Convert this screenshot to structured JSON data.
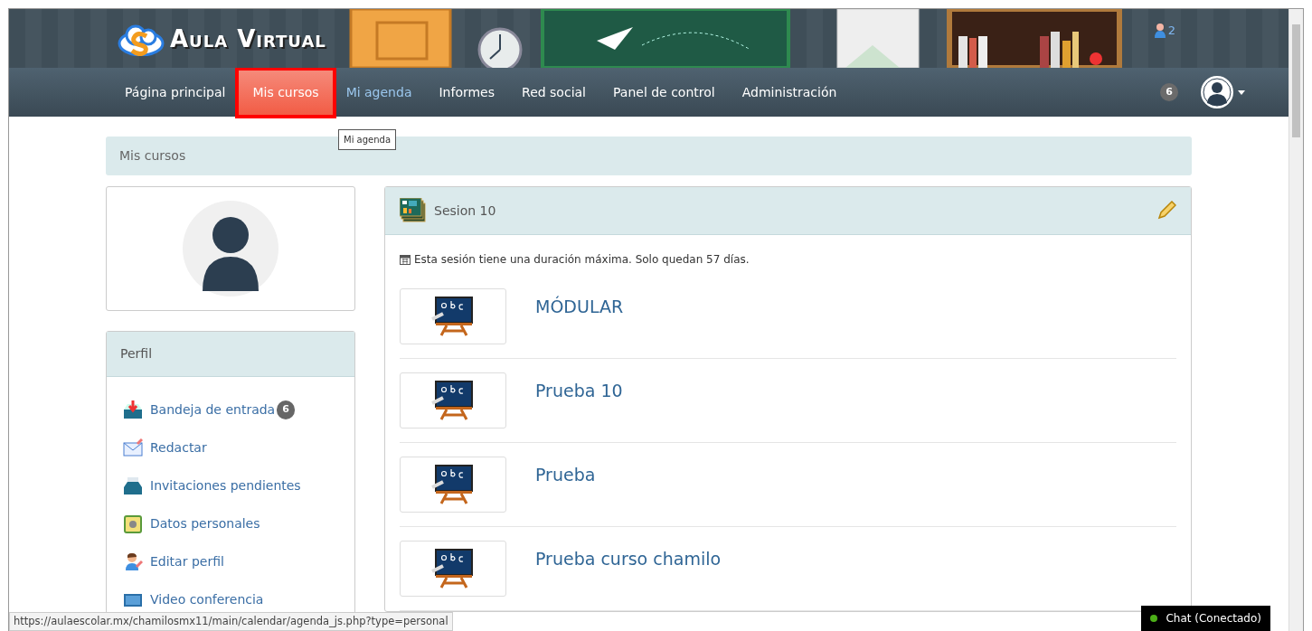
{
  "header": {
    "logo_text": "Aula Virtual",
    "online_count": "2"
  },
  "nav": {
    "items": [
      {
        "label": "Página principal",
        "selected": false,
        "hovered": false
      },
      {
        "label": "Mis cursos",
        "selected": true,
        "hovered": false
      },
      {
        "label": "Mi agenda",
        "selected": false,
        "hovered": true
      },
      {
        "label": "Informes",
        "selected": false,
        "hovered": false
      },
      {
        "label": "Red social",
        "selected": false,
        "hovered": false
      },
      {
        "label": "Panel de control",
        "selected": false,
        "hovered": false
      },
      {
        "label": "Administración",
        "selected": false,
        "hovered": false
      }
    ],
    "tooltip": "Mi agenda",
    "notification_count": "6"
  },
  "breadcrumb": "Mis cursos",
  "profile": {
    "title": "Perfil",
    "items": [
      {
        "kind": "inbox",
        "label": "Bandeja de entrada",
        "badge": "6"
      },
      {
        "kind": "compose",
        "label": "Redactar"
      },
      {
        "kind": "invitations",
        "label": "Invitaciones pendientes"
      },
      {
        "kind": "personal-data",
        "label": "Datos personales"
      },
      {
        "kind": "edit-profile",
        "label": "Editar perfil"
      },
      {
        "kind": "video",
        "label": "Video conferencia"
      }
    ]
  },
  "session": {
    "title": "Sesion 10",
    "notice": "Esta sesión tiene una duración máxima. Solo quedan 57 días.",
    "courses": [
      {
        "title": "MÓDULAR"
      },
      {
        "title": "Prueba 10"
      },
      {
        "title": "Prueba"
      },
      {
        "title": "Prueba curso chamilo"
      }
    ]
  },
  "status_url": "https://aulaescolar.mx/chamilosmx11/main/calendar/agenda_js.php?type=personal",
  "chat": {
    "label": "Chat (Conectado)",
    "connected": true
  }
}
